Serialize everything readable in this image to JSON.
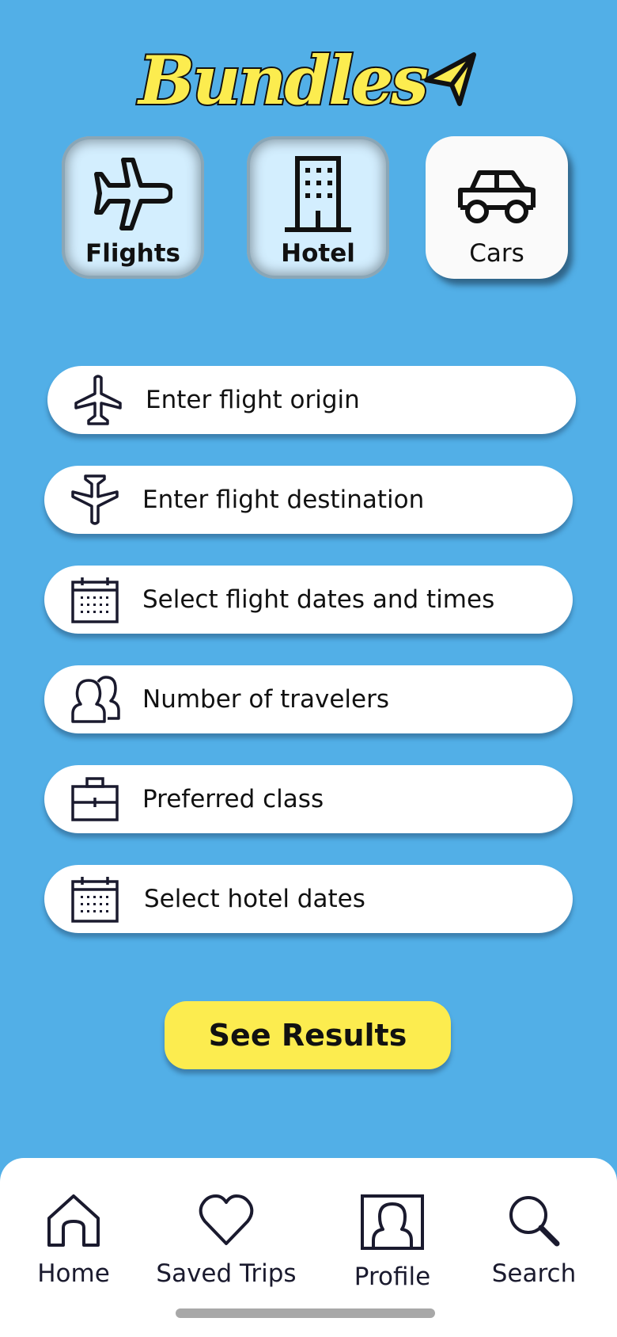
{
  "app": {
    "logo_text": "Bundles"
  },
  "tabs": [
    {
      "label": "Flights",
      "icon": "plane-icon",
      "state": "selected"
    },
    {
      "label": "Hotel",
      "icon": "building-icon",
      "state": "selected"
    },
    {
      "label": "Cars",
      "icon": "car-icon",
      "state": "unselected"
    }
  ],
  "fields": [
    {
      "label": "Enter flight origin",
      "icon": "plane-takeoff-icon"
    },
    {
      "label": "Enter flight destination",
      "icon": "plane-landing-icon"
    },
    {
      "label": "Select flight dates and times",
      "icon": "calendar-icon"
    },
    {
      "label": "Number of travelers",
      "icon": "people-icon"
    },
    {
      "label": "Preferred class",
      "icon": "briefcase-icon"
    },
    {
      "label": "Select hotel dates",
      "icon": "calendar-icon"
    }
  ],
  "actions": {
    "see_results": "See Results"
  },
  "nav": [
    {
      "label": "Home",
      "icon": "home-icon"
    },
    {
      "label": "Saved Trips",
      "icon": "heart-icon"
    },
    {
      "label": "Profile",
      "icon": "profile-icon"
    },
    {
      "label": "Search",
      "icon": "search-icon"
    }
  ],
  "colors": {
    "background": "#52afe7",
    "accent_yellow": "#fcec4f",
    "tab_selected": "#d3eefe",
    "text_dark": "#111111"
  }
}
